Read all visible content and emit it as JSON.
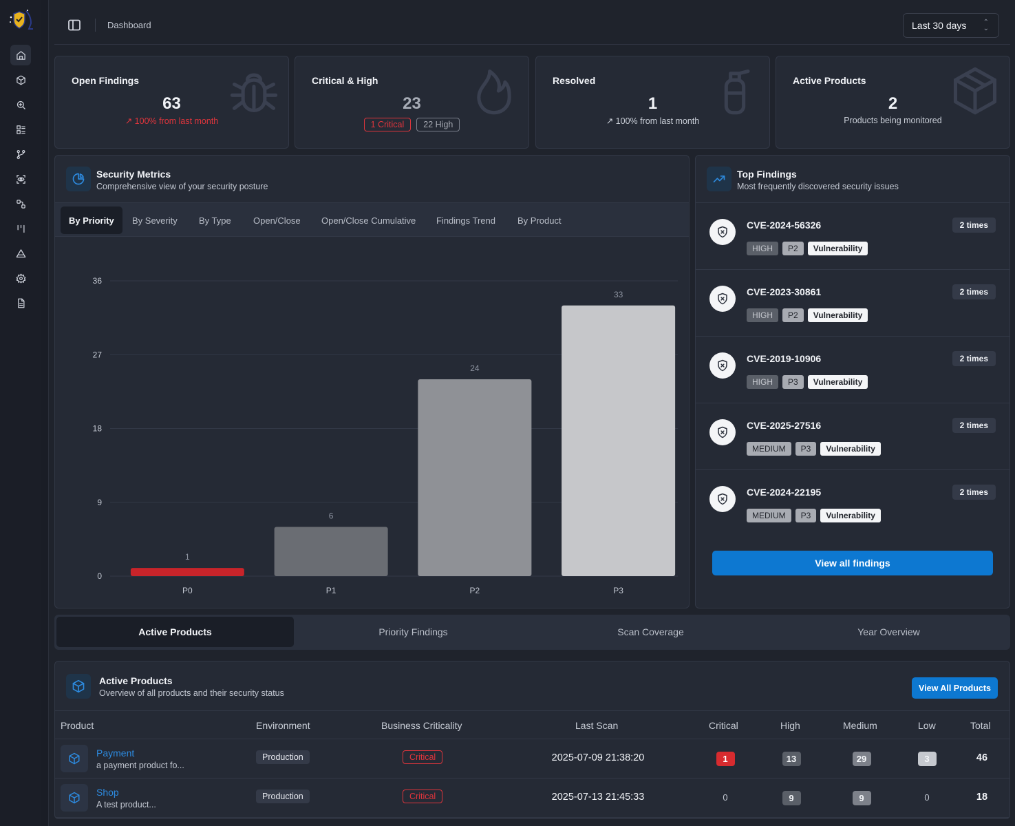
{
  "header": {
    "breadcrumb": "Dashboard",
    "range_select": "Last 30 days"
  },
  "stats": [
    {
      "title": "Open Findings",
      "value": "63",
      "sub": "100% from last month",
      "icon": "bug-icon"
    },
    {
      "title": "Critical & High",
      "value": "23",
      "critical_pill": "1 Critical",
      "high_pill": "22 High",
      "icon": "flame-icon"
    },
    {
      "title": "Resolved",
      "value": "1",
      "sub": "100% from last month",
      "icon": "fire-extinguisher-icon"
    },
    {
      "title": "Active Products",
      "value": "2",
      "sub": "Products being monitored",
      "icon": "box-icon"
    }
  ],
  "metrics": {
    "title": "Security Metrics",
    "subtitle": "Comprehensive view of your security posture",
    "tabs": [
      "By Priority",
      "By Severity",
      "By Type",
      "Open/Close",
      "Open/Close Cumulative",
      "Findings Trend",
      "By Product"
    ]
  },
  "chart_data": {
    "type": "bar",
    "categories": [
      "P0",
      "P1",
      "P2",
      "P3"
    ],
    "values": [
      1,
      6,
      24,
      33
    ],
    "data_labels": [
      "1",
      "6",
      "24",
      "33"
    ],
    "colors": [
      "#c8242a",
      "#6a6d73",
      "#8f9196",
      "#c6c7ca"
    ],
    "ylim": [
      0,
      36
    ],
    "yticks": [
      0,
      9,
      18,
      27,
      36
    ],
    "ytick_labels": [
      "0",
      "9",
      "18",
      "27",
      "36"
    ],
    "grid": true
  },
  "top_findings": {
    "title": "Top Findings",
    "subtitle": "Most frequently discovered security issues",
    "items": [
      {
        "cve": "CVE-2024-56326",
        "times": "2 times",
        "severity": "HIGH",
        "priority": "P2",
        "type": "Vulnerability"
      },
      {
        "cve": "CVE-2023-30861",
        "times": "2 times",
        "severity": "HIGH",
        "priority": "P2",
        "type": "Vulnerability"
      },
      {
        "cve": "CVE-2019-10906",
        "times": "2 times",
        "severity": "HIGH",
        "priority": "P3",
        "type": "Vulnerability"
      },
      {
        "cve": "CVE-2025-27516",
        "times": "2 times",
        "severity": "MEDIUM",
        "priority": "P3",
        "type": "Vulnerability"
      },
      {
        "cve": "CVE-2024-22195",
        "times": "2 times",
        "severity": "MEDIUM",
        "priority": "P3",
        "type": "Vulnerability"
      }
    ],
    "view_all": "View all findings"
  },
  "bottom_tabs": [
    "Active Products",
    "Priority Findings",
    "Scan Coverage",
    "Year Overview"
  ],
  "products": {
    "title": "Active Products",
    "subtitle": "Overview of all products and their security status",
    "view_all": "View All Products",
    "columns": [
      "Product",
      "Environment",
      "Business Criticality",
      "Last Scan",
      "Critical",
      "High",
      "Medium",
      "Low",
      "Total"
    ],
    "rows": [
      {
        "name": "Payment",
        "desc": "a payment product fo...",
        "env": "Production",
        "criticality": "Critical",
        "last_scan": "2025-07-09 21:38:20",
        "critical": "1",
        "high": "13",
        "medium": "29",
        "low": "3",
        "total": "46"
      },
      {
        "name": "Shop",
        "desc": "A test product...",
        "env": "Production",
        "criticality": "Critical",
        "last_scan": "2025-07-13 21:45:33",
        "critical": "0",
        "high": "9",
        "medium": "9",
        "low": "0",
        "total": "18"
      }
    ]
  }
}
